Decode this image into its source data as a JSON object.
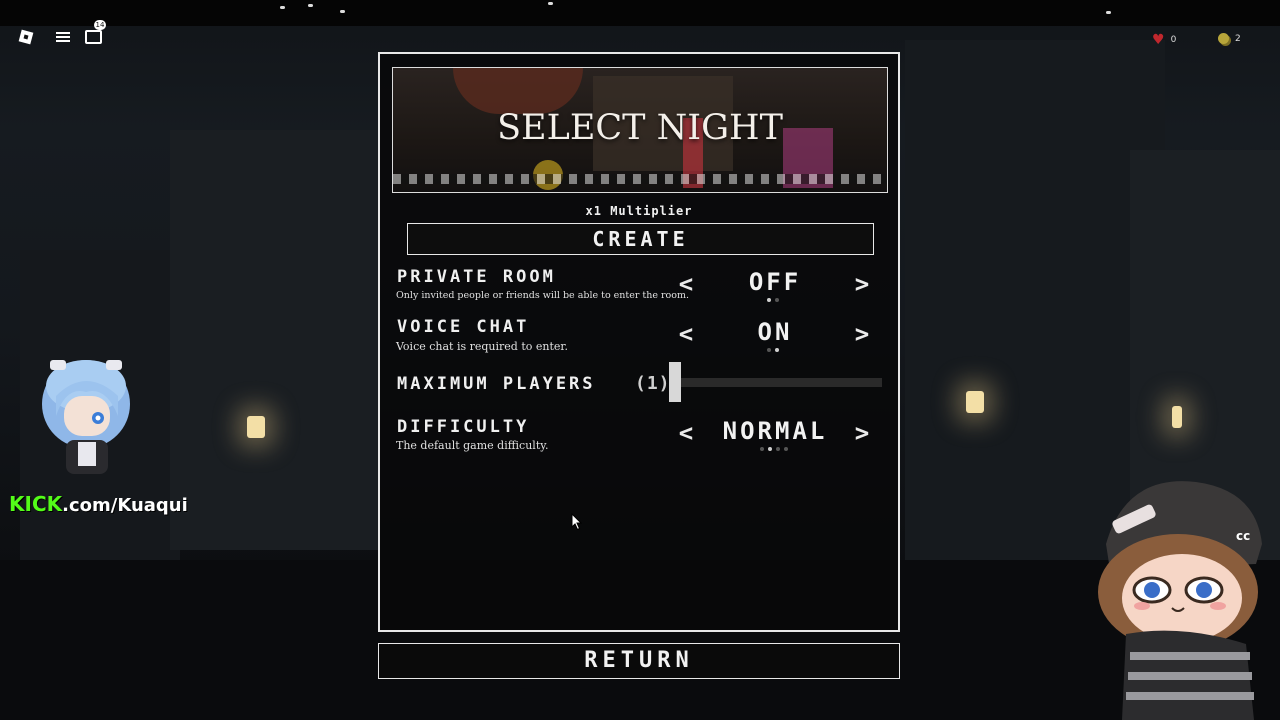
{
  "topbar": {
    "chat_badge": "14",
    "hearts": "0",
    "coins": "2"
  },
  "panel": {
    "banner_title": "SELECT NIGHT",
    "multiplier": "x1 Multiplier",
    "create_label": "CREATE",
    "options": {
      "private_room": {
        "title": "PRIVATE ROOM",
        "description": "Only invited people or friends will be able to enter the room.",
        "value": "OFF",
        "prev": "<",
        "next": ">"
      },
      "voice_chat": {
        "title": "VOICE CHAT",
        "description": "Voice chat is required to enter.",
        "value": "ON",
        "prev": "<",
        "next": ">"
      },
      "max_players": {
        "title": "MAXIMUM PLAYERS",
        "value": "(1)",
        "slider_fraction": 0.0
      },
      "difficulty": {
        "title": "DIFFICULTY",
        "description": "The default game difficulty.",
        "value": "NORMAL",
        "prev": "<",
        "next": ">"
      }
    }
  },
  "return_label": "RETURN",
  "overlay": {
    "kick_brand": "KICK",
    "kick_path": ".com/Kuaqui"
  },
  "colors": {
    "panel_border": "#e8e8e8",
    "kick_green": "#53fc18",
    "heart_red": "#c0272d"
  }
}
